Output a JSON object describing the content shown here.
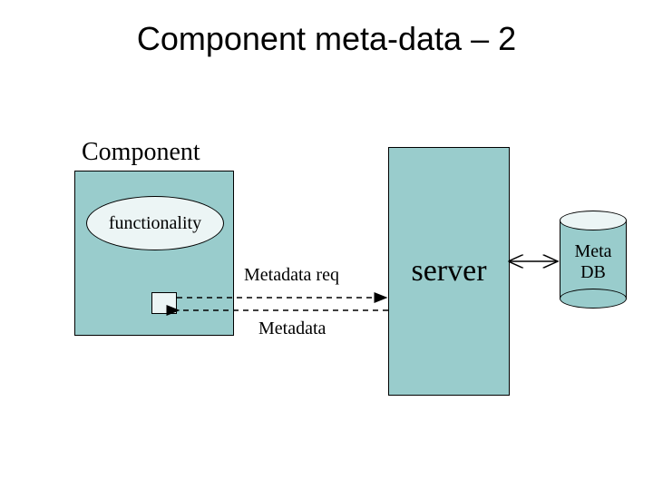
{
  "title": "Component meta-data – 2",
  "component": {
    "label": "Component",
    "functionality": "functionality"
  },
  "server": {
    "label": "server"
  },
  "metadb": {
    "line1": "Meta",
    "line2": "DB"
  },
  "arrows": {
    "request": "Metadata req",
    "response": "Metadata"
  }
}
